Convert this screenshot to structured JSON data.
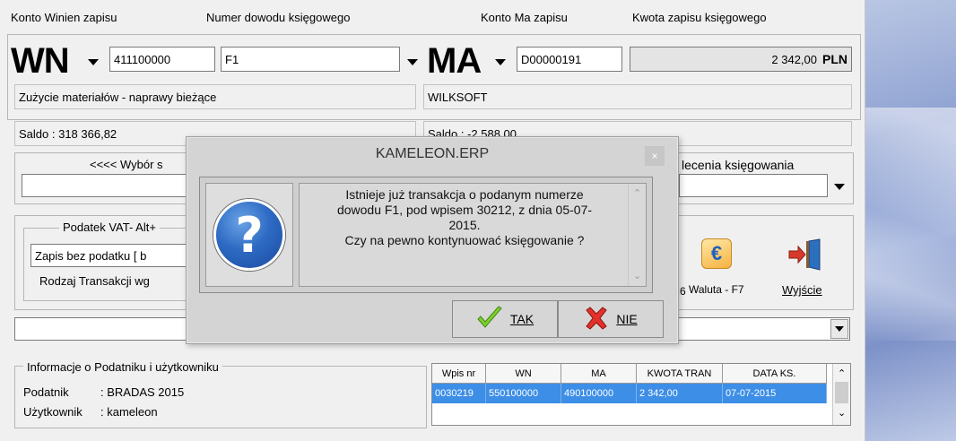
{
  "header": {
    "konto_wn_label": "Konto  Winien  zapisu",
    "numer_label": "Numer dowodu księgowego",
    "konto_ma_label": "Konto   Ma   zapisu",
    "kwota_label": "Kwota zapisu księgowego"
  },
  "wn": {
    "big_label": "WN",
    "account": "411100000",
    "document": "F1",
    "description": "Zużycie materiałów - naprawy bieżące",
    "saldo": "Saldo : 318 366,82"
  },
  "ma": {
    "big_label": "MA",
    "account": "D00000191",
    "amount": "2 342,00",
    "currency": "PLN",
    "description": "WILKSOFT",
    "saldo": "Saldo : -2 588,00"
  },
  "wybor_label": "<<<<   Wybór s",
  "polecenia_label": "lecenia księgowania",
  "vat": {
    "legend": "Podatek VAT- Alt+",
    "value": "Zapis bez podatku [ b",
    "rodzaj": "Rodzaj Transakcji wg"
  },
  "toolbar": {
    "waluta_label": "Waluta - F7",
    "prev_fragment": "6",
    "exit_label": "Wyjście"
  },
  "info": {
    "legend": "Informacje o Podatniku i użytkowniku",
    "podatnik_label": "Podatnik",
    "podatnik_value": ": BRADAS 2015",
    "uzytkownik_label": "Użytkownik",
    "uzytkownik_value": ": kameleon"
  },
  "table": {
    "headers": [
      "Wpis nr",
      "WN",
      "MA",
      "KWOTA TRAN",
      "DATA KS."
    ],
    "rows": [
      [
        "0030219",
        "550100000",
        "490100000",
        "2 342,00",
        "07-07-2015"
      ]
    ]
  },
  "dialog": {
    "title": "KAMELEON.ERP",
    "close": "×",
    "message": "Istnieje już transakcja o podanym numerze\ndowodu F1, pod wpisem 30212, z dnia 05-07-\n2015.\nCzy na pewno kontynuować księgowanie ?",
    "yes_label": "TAK",
    "no_label": "NIE",
    "icon_glyph": "?"
  },
  "colors": {
    "selection": "#3d8ee6",
    "accent": "#1b4aa0"
  }
}
